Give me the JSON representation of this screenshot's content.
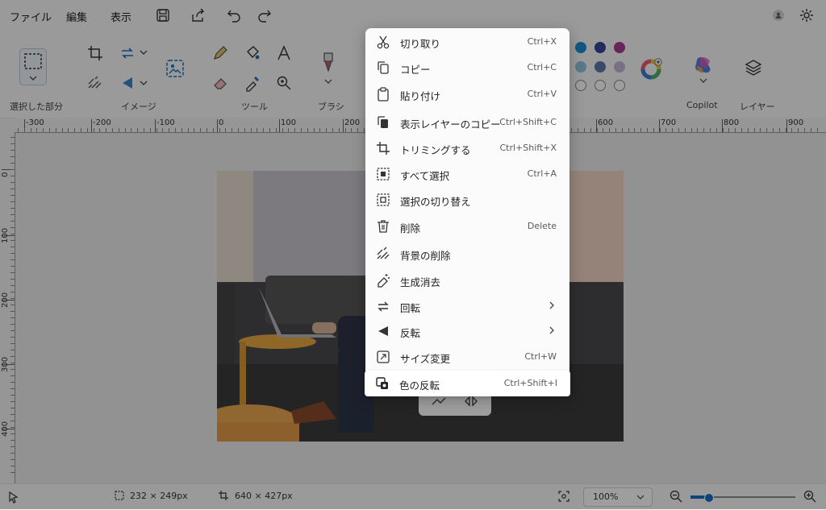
{
  "menubar": {
    "file": "ファイル",
    "edit": "編集",
    "view": "表示",
    "icons": [
      "save-icon",
      "share-icon",
      "undo-icon",
      "redo-icon",
      "account-icon",
      "settings-icon"
    ]
  },
  "ribbon": {
    "groups": {
      "selection": "選択した部分",
      "image": "イメージ",
      "tools": "ツール",
      "brush": "ブラシ",
      "copilot": "Copilot",
      "layers": "レイヤー"
    },
    "colors": {
      "row1": [
        "#1b8fd0",
        "#36469a",
        "#a83c92"
      ],
      "row2": [
        "#8fc4dd",
        "#5f7aa6",
        "#c2b6d6"
      ],
      "row3": [
        "#ffffff",
        "#ffffff",
        "#ffffff"
      ]
    }
  },
  "rulers": {
    "horizontal": [
      "-300",
      "-200",
      "-100",
      "0",
      "100",
      "200",
      "600",
      "700",
      "800",
      "900"
    ],
    "vertical": [
      "0",
      "100",
      "200",
      "300",
      "400"
    ]
  },
  "context_menu": {
    "items": [
      {
        "icon": "scissors-icon",
        "label": "切り取り",
        "shortcut": "Ctrl+X"
      },
      {
        "icon": "copy-icon",
        "label": "コピー",
        "shortcut": "Ctrl+C"
      },
      {
        "icon": "paste-icon",
        "label": "貼り付け",
        "shortcut": "Ctrl+V"
      },
      {
        "icon": "copy-layer-icon",
        "label": "表示レイヤーのコピー",
        "shortcut": "Ctrl+Shift+C"
      },
      {
        "icon": "crop-icon",
        "label": "トリミングする",
        "shortcut": "Ctrl+Shift+X"
      },
      {
        "icon": "select-all-icon",
        "label": "すべて選択",
        "shortcut": "Ctrl+A"
      },
      {
        "icon": "invert-selection-icon",
        "label": "選択の切り替え",
        "shortcut": ""
      },
      {
        "icon": "trash-icon",
        "label": "削除",
        "shortcut": "Delete"
      },
      {
        "icon": "remove-background-icon",
        "label": "背景の削除",
        "shortcut": ""
      },
      {
        "icon": "generative-erase-icon",
        "label": "生成消去",
        "shortcut": ""
      },
      {
        "icon": "rotate-icon",
        "label": "回転",
        "shortcut": ""
      },
      {
        "icon": "flip-icon",
        "label": "反転",
        "shortcut": ""
      },
      {
        "icon": "resize-icon",
        "label": "サイズ変更",
        "shortcut": "Ctrl+W"
      },
      {
        "icon": "invert-colors-icon",
        "label": "色の反転",
        "shortcut": "Ctrl+Shift+I"
      }
    ]
  },
  "statusbar": {
    "selection_size": "232 × 249px",
    "image_size": "640 × 427px",
    "zoom": "100%"
  }
}
